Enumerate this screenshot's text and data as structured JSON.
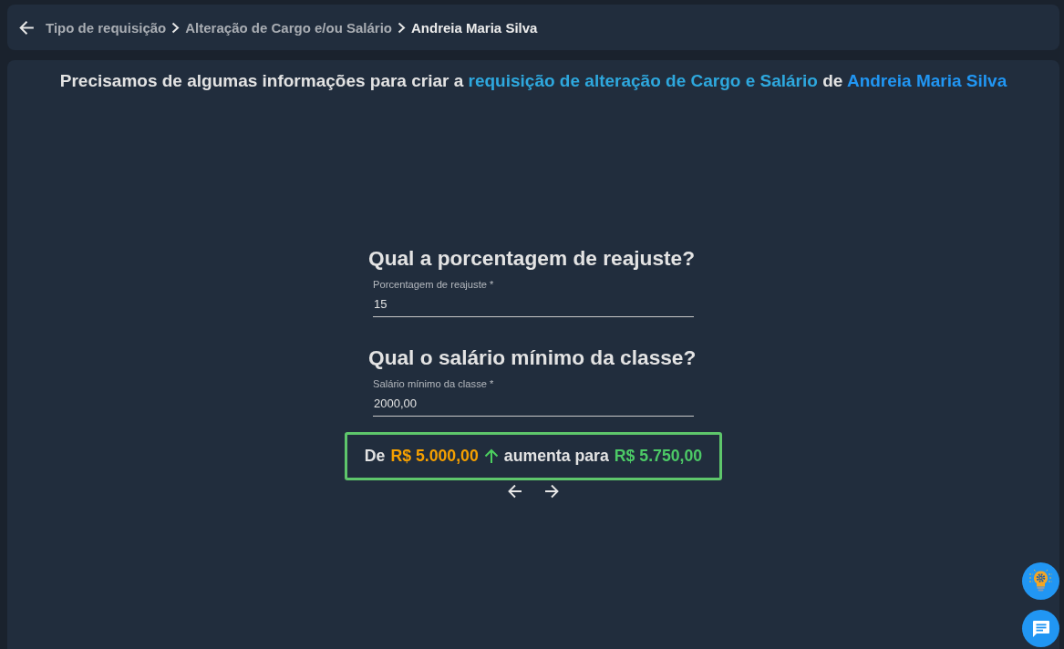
{
  "breadcrumb": {
    "items": [
      {
        "label": "Tipo de requisição",
        "current": false
      },
      {
        "label": "Alteração de Cargo e/ou Salário",
        "current": false
      },
      {
        "label": "Andreia Maria Silva",
        "current": true
      }
    ]
  },
  "intro": [
    {
      "kind": "plain",
      "text": "Precisamos de algumas informações para criar a"
    },
    {
      "kind": "highlight",
      "text": "requisição de alteração de Cargo e Salário",
      "color": "#2ea8de"
    },
    {
      "kind": "plain",
      "text": "de"
    },
    {
      "kind": "highlight",
      "text": "Andreia Maria Silva",
      "color": "#2196f3"
    }
  ],
  "questions": [
    {
      "title": "Qual a porcentagem de reajuste?",
      "field": {
        "label": "Porcentagem de reajuste *",
        "value": "15"
      }
    },
    {
      "title": "Qual o salário mínimo da classe?",
      "field": {
        "label": "Salário mínimo da classe *",
        "value": "2000,00"
      }
    }
  ],
  "summary": {
    "prefix": "De",
    "from": "R$ 5.000,00",
    "increased": true,
    "middle": "aumenta para",
    "to": "R$ 5.750,00"
  }
}
